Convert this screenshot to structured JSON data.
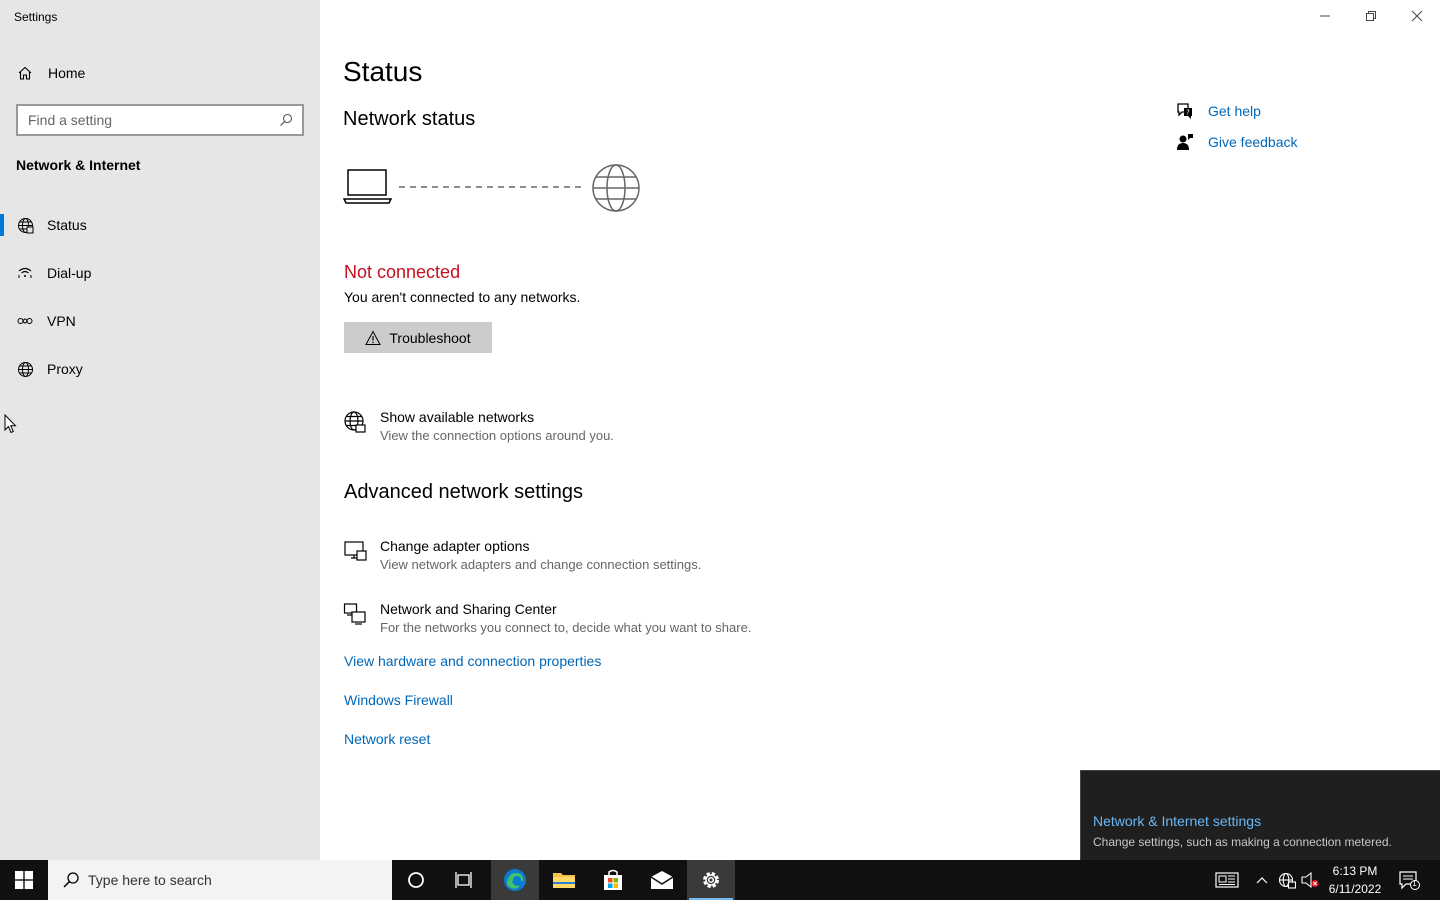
{
  "window": {
    "title": "Settings"
  },
  "sidebar": {
    "home_label": "Home",
    "search_placeholder": "Find a setting",
    "section_title": "Network & Internet",
    "items": [
      {
        "label": "Status",
        "icon": "globe-status-icon",
        "active": true
      },
      {
        "label": "Dial-up",
        "icon": "dialup-icon"
      },
      {
        "label": "VPN",
        "icon": "vpn-icon"
      },
      {
        "label": "Proxy",
        "icon": "globe-icon"
      }
    ]
  },
  "main": {
    "title": "Status",
    "network_status_title": "Network status",
    "connection_status": "Not connected",
    "connection_desc": "You aren't connected to any networks.",
    "troubleshoot_label": "Troubleshoot",
    "show_networks": {
      "title": "Show available networks",
      "desc": "View the connection options around you."
    },
    "advanced_title": "Advanced network settings",
    "adapter": {
      "title": "Change adapter options",
      "desc": "View network adapters and change connection settings."
    },
    "sharing": {
      "title": "Network and Sharing Center",
      "desc": "For the networks you connect to, decide what you want to share."
    },
    "links": {
      "hardware": "View hardware and connection properties",
      "firewall": "Windows Firewall",
      "reset": "Network reset"
    }
  },
  "help": {
    "get_help": "Get help",
    "give_feedback": "Give feedback"
  },
  "toast": {
    "title": "Network & Internet settings",
    "desc": "Change settings, such as making a connection metered."
  },
  "taskbar": {
    "search_placeholder": "Type here to search",
    "time": "6:13 PM",
    "date": "6/11/2022",
    "notification_count": "1"
  },
  "colors": {
    "accent": "#0078d7",
    "error": "#c50f1f",
    "link": "#0067b8"
  }
}
